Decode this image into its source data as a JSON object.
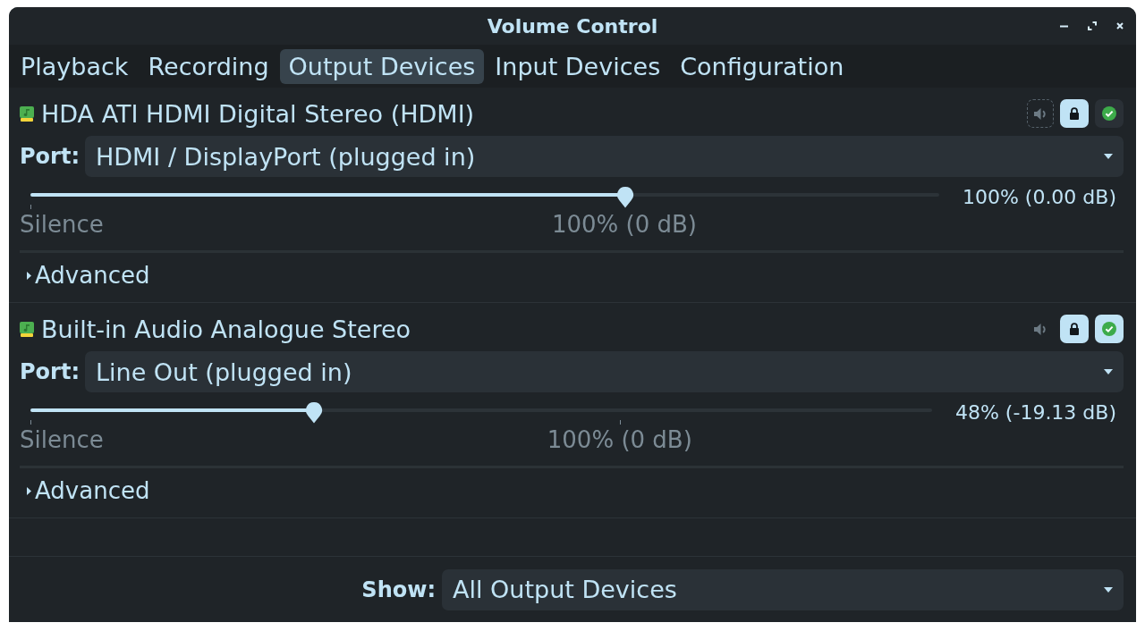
{
  "window": {
    "title": "Volume Control"
  },
  "tabs": [
    {
      "label": "Playback",
      "selected": false
    },
    {
      "label": "Recording",
      "selected": false
    },
    {
      "label": "Output Devices",
      "selected": true
    },
    {
      "label": "Input Devices",
      "selected": false
    },
    {
      "label": "Configuration",
      "selected": false
    }
  ],
  "devices": [
    {
      "name": "HDA ATI HDMI Digital Stereo (HDMI)",
      "muted": false,
      "mute_focused": true,
      "lock_channels": true,
      "default": false,
      "port": {
        "label": "Port:",
        "value": "HDMI / DisplayPort (plugged in)"
      },
      "volume": {
        "level": 0.655,
        "reading": "100% (0.00 dB)",
        "marks": [
          {
            "kind": "start",
            "label": "Silence"
          },
          {
            "kind": "norm",
            "label": "100% (0 dB)"
          }
        ]
      },
      "advanced": {
        "label": "Advanced",
        "expanded": false
      }
    },
    {
      "name": "Built-in Audio Analogue Stereo",
      "muted": false,
      "mute_focused": false,
      "lock_channels": true,
      "default": true,
      "port": {
        "label": "Port:",
        "value": "Line Out (plugged in)"
      },
      "volume": {
        "level": 0.314,
        "reading": "48% (-19.13 dB)",
        "marks": [
          {
            "kind": "start",
            "label": "Silence"
          },
          {
            "kind": "norm",
            "label": "100% (0 dB)"
          }
        ]
      },
      "advanced": {
        "label": "Advanced",
        "expanded": false
      }
    }
  ],
  "show": {
    "label": "Show:",
    "value": "All Output Devices"
  }
}
